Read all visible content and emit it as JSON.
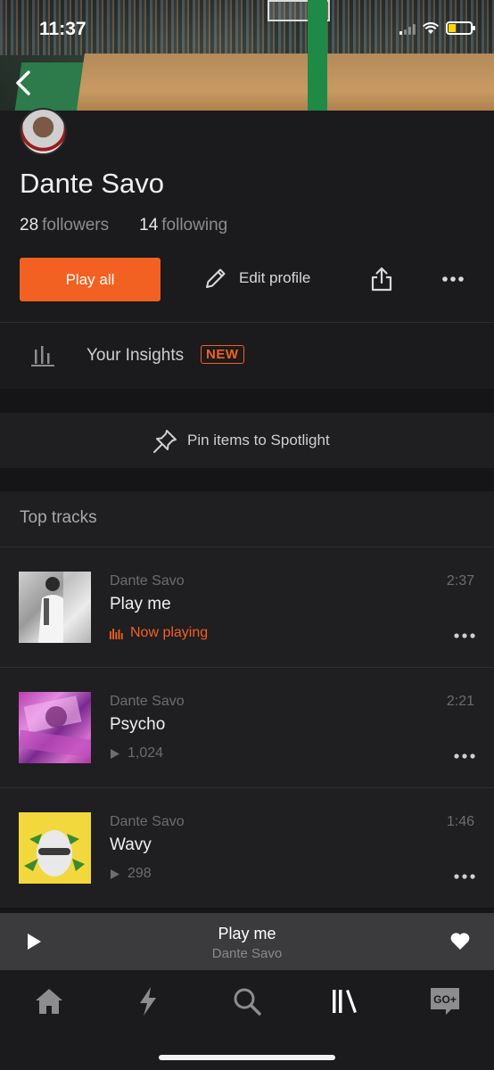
{
  "status_bar": {
    "time": "11:37"
  },
  "profile": {
    "name": "Dante Savo",
    "followers_count": "28",
    "followers_label": "followers",
    "following_count": "14",
    "following_label": "following"
  },
  "actions": {
    "play_all": "Play all",
    "edit_profile": "Edit profile"
  },
  "insights": {
    "label": "Your Insights",
    "badge": "NEW"
  },
  "spotlight": {
    "label": "Pin items to Spotlight"
  },
  "top_tracks": {
    "header": "Top tracks",
    "tracks": [
      {
        "artist": "Dante Savo",
        "title": "Play me",
        "duration": "2:37",
        "status": "Now playing"
      },
      {
        "artist": "Dante Savo",
        "title": "Psycho",
        "duration": "2:21",
        "plays": "1,024"
      },
      {
        "artist": "Dante Savo",
        "title": "Wavy",
        "duration": "1:46",
        "plays": "298"
      }
    ]
  },
  "mini_player": {
    "title": "Play me",
    "artist": "Dante Savo"
  },
  "tabs": [
    "home-icon",
    "stream-icon",
    "search-icon",
    "library-icon",
    "go-plus-icon"
  ],
  "colors": {
    "accent": "#f26122",
    "background": "#1b1a1c",
    "row": "#1f1e20",
    "mini_player": "#3b3a3d"
  }
}
